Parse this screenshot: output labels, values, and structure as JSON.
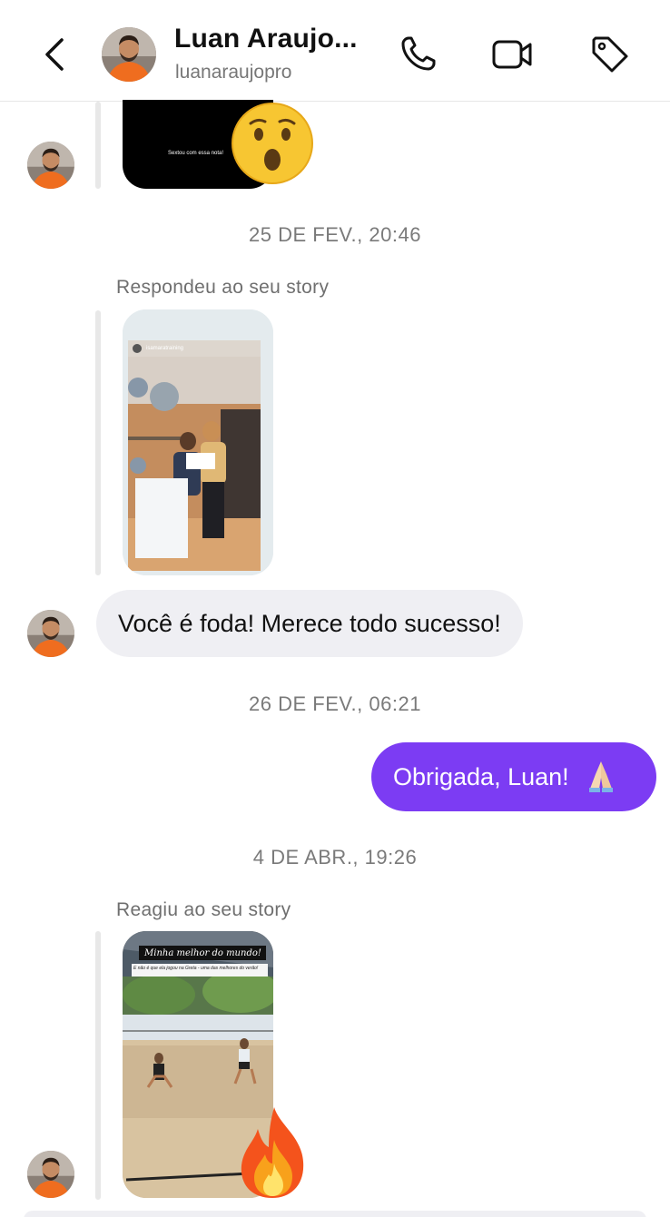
{
  "header": {
    "name": "Luan Araujo...",
    "username": "luanaraujopro"
  },
  "messages": {
    "story1_caption": "Sextou com essa nota!",
    "time1": "25 DE FEV., 20:46",
    "meta1": "Respondeu ao seu story",
    "story2_user": "isamaratraining",
    "incoming_text": "Você é foda! Merece todo sucesso!",
    "time2": "26 DE FEV., 06:21",
    "outgoing_text": "Obrigada, Luan!",
    "time3": "4 DE ABR., 19:26",
    "meta2": "Reagiu ao seu story",
    "story3_title": "Minha melhor do mundo!",
    "story3_subtitle": "E não é que ela jogou na Greta - uma das melhores do verão!"
  },
  "colors": {
    "accent": "#7c3cf3",
    "incoming_bubble": "#efeff3",
    "timestamp": "#7a7a7a"
  },
  "icons": {
    "back": "chevron-left",
    "call": "phone",
    "video": "video-camera",
    "tag": "tag",
    "reaction1": "astonished-face",
    "reaction2": "fire",
    "pray": "folded-hands"
  }
}
